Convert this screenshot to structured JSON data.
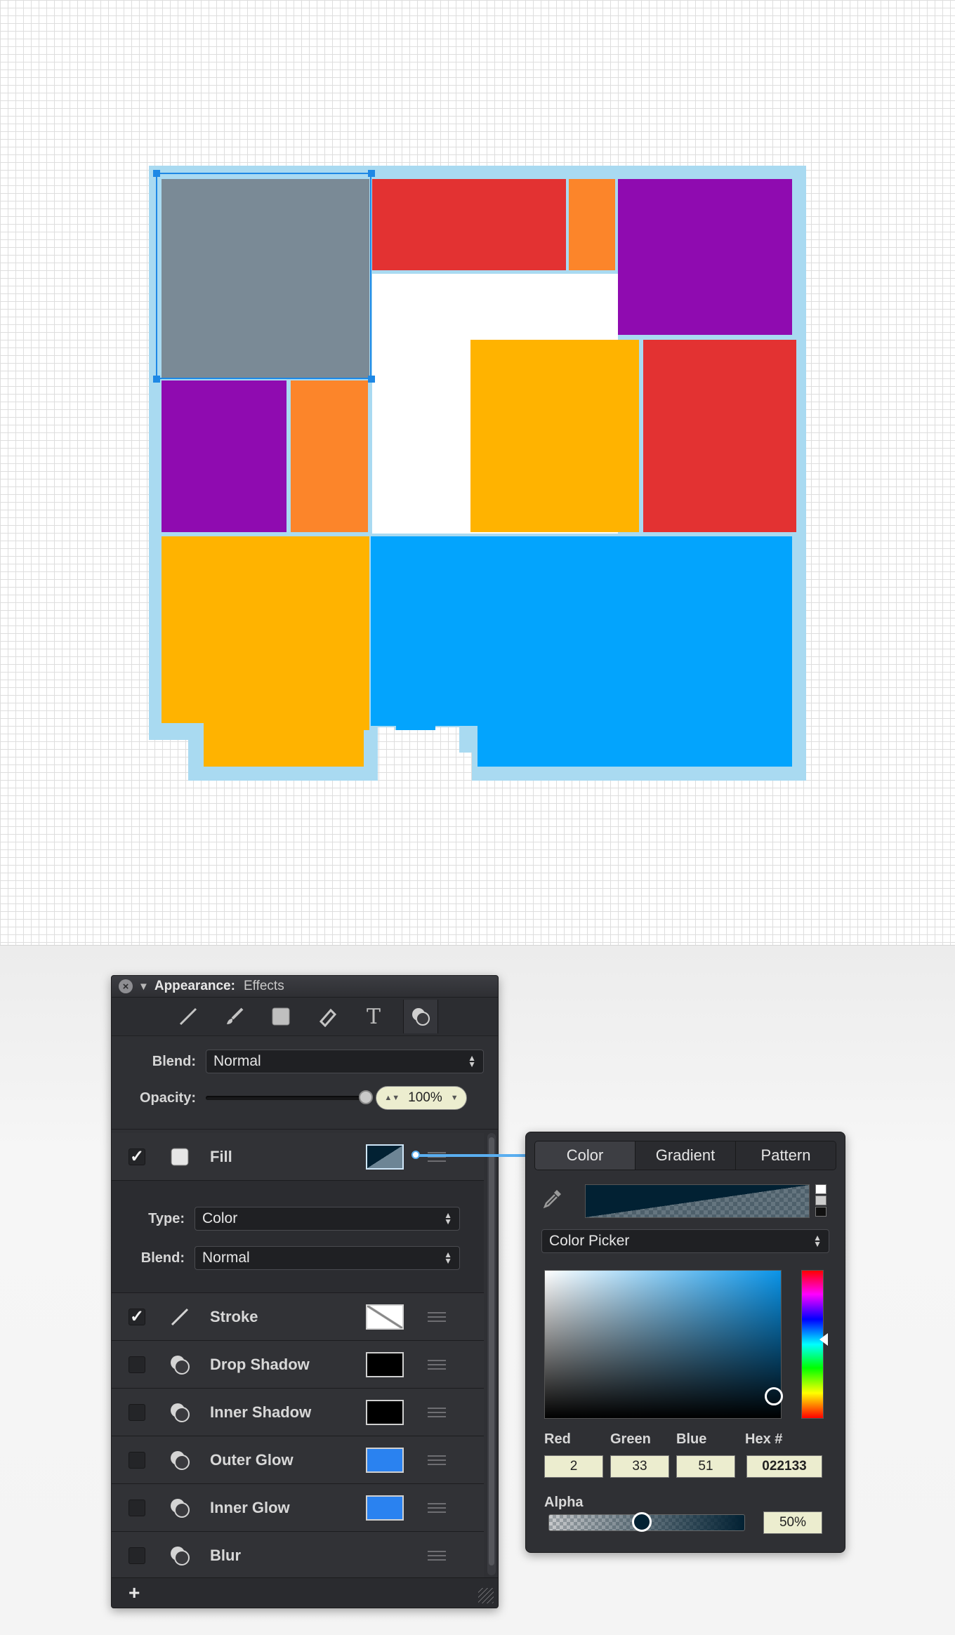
{
  "appearance_panel": {
    "title": "Appearance:",
    "subtitle": "Effects",
    "tools": [
      "line-tool-icon",
      "brush-icon",
      "fill-square-icon",
      "eraser-icon",
      "text-tool-icon",
      "effects-icon"
    ],
    "blend_label": "Blend:",
    "blend_value": "Normal",
    "opacity_label": "Opacity:",
    "opacity_value": "100%",
    "opacity_level": 1.0,
    "fill": {
      "checked": true,
      "label": "Fill",
      "swatch_color": "#022133",
      "type_label": "Type:",
      "type_value": "Color",
      "blend_label": "Blend:",
      "blend_value": "Normal"
    },
    "effects": [
      {
        "label": "Stroke",
        "checked": true,
        "swatch": "#ffffff",
        "icon": "stroke-line-icon"
      },
      {
        "label": "Drop Shadow",
        "checked": false,
        "swatch": "#000000",
        "icon": "effect-ball-icon"
      },
      {
        "label": "Inner Shadow",
        "checked": false,
        "swatch": "#000000",
        "icon": "effect-ball-icon"
      },
      {
        "label": "Outer Glow",
        "checked": false,
        "swatch": "#2a82f0",
        "icon": "effect-ball-icon"
      },
      {
        "label": "Inner Glow",
        "checked": false,
        "swatch": "#2a82f0",
        "icon": "effect-ball-icon"
      },
      {
        "label": "Blur",
        "checked": false,
        "swatch": "",
        "icon": "effect-ball-icon"
      }
    ],
    "add_label": "+"
  },
  "color_popover": {
    "tabs": [
      "Color",
      "Gradient",
      "Pattern"
    ],
    "selected_tab": "Color",
    "picker_mode": "Color Picker",
    "channels": {
      "red_label": "Red",
      "red": "2",
      "green_label": "Green",
      "green": "33",
      "blue_label": "Blue",
      "blue": "51",
      "hex_label": "Hex #",
      "hex": "022133"
    },
    "alpha_label": "Alpha",
    "alpha_value": "50%",
    "alpha_level": 0.5,
    "current_color": "#022133"
  },
  "artwork_colors": {
    "gray": "#7a8a96",
    "red": "#e33232",
    "orange": "#fc852a",
    "purple": "#8f0bb0",
    "amber": "#ffb300",
    "blue": "#03a4fd",
    "white": "#ffffff",
    "stroke": "#a9daf1",
    "selection": "#1e88e5"
  }
}
